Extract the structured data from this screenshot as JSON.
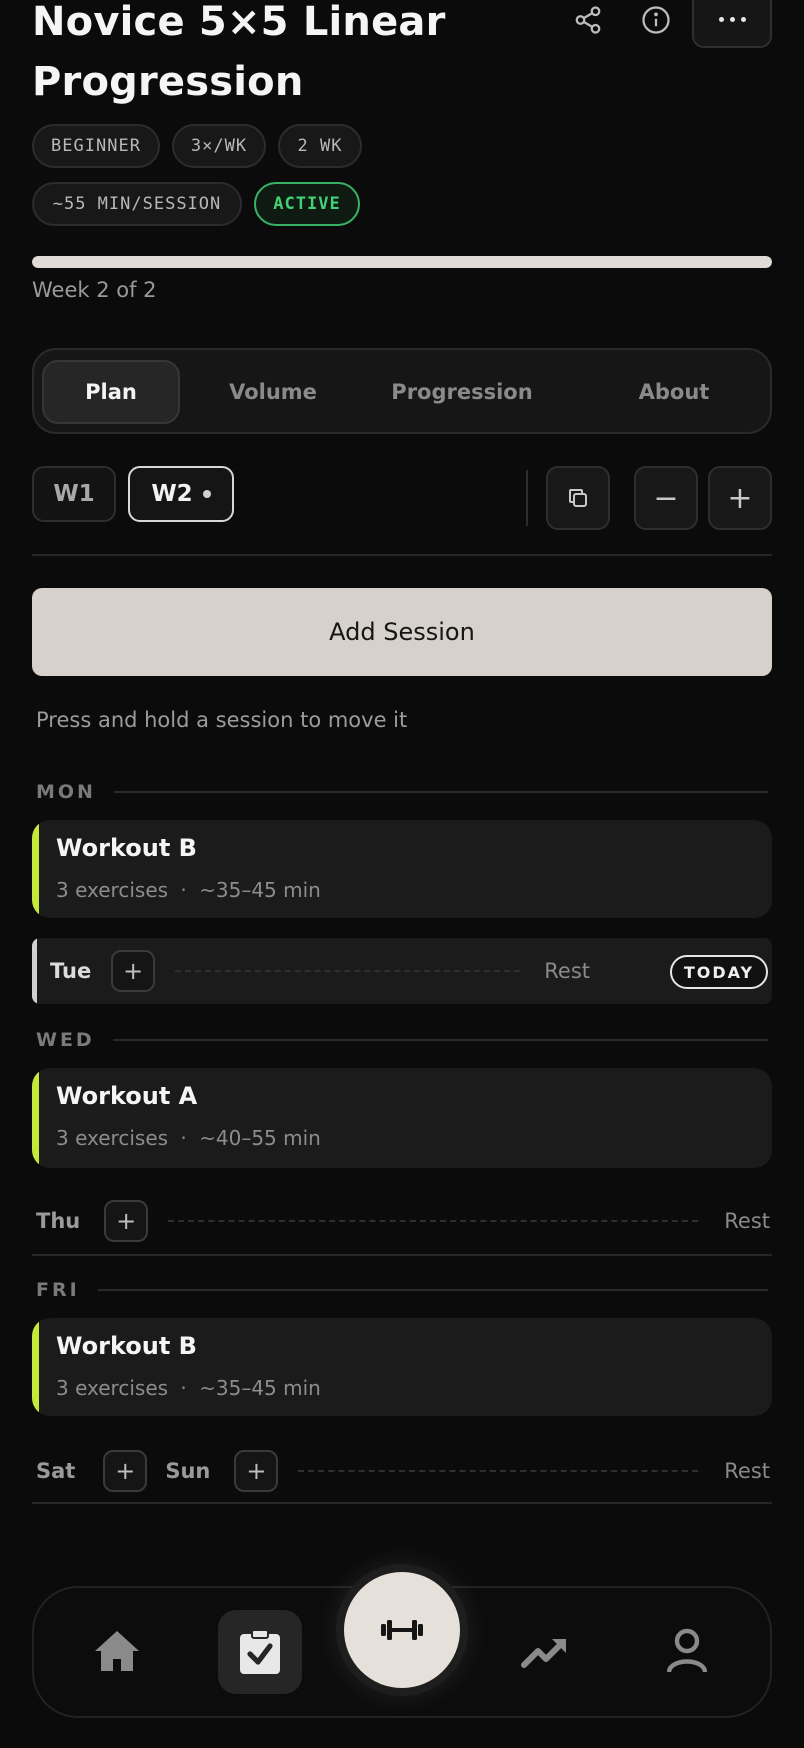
{
  "program": {
    "title": "Novice 5×5 Linear Progression",
    "tags": [
      "BEGINNER",
      "3×/WK",
      "2 WK",
      "~55 MIN/SESSION"
    ],
    "status": "ACTIVE",
    "progress_fraction": 1.0,
    "week_label": "Week 2 of 2"
  },
  "header_icons": [
    "share-icon",
    "info-icon",
    "more-icon"
  ],
  "tabs": [
    {
      "label": "Plan",
      "selected": true
    },
    {
      "label": "Volume",
      "selected": false
    },
    {
      "label": "Progression",
      "selected": false
    },
    {
      "label": "About",
      "selected": false
    }
  ],
  "weeks": [
    {
      "label": "W1",
      "selected": false
    },
    {
      "label": "W2",
      "selected": true
    }
  ],
  "week_actions": {
    "duplicate_icon": "copy-icon",
    "remove": "−",
    "add": "+"
  },
  "add_session_label": "Add Session",
  "hint": "Press and hold a session to move it",
  "schedule": {
    "mon": {
      "header": "MON",
      "name": "Workout B",
      "exercises": "3 exercises",
      "sep": "·",
      "duration": "~35–45 min"
    },
    "tue": {
      "day": "Tue",
      "add": "+",
      "rest": "Rest",
      "badge": "TODAY"
    },
    "wed": {
      "header": "WED",
      "name": "Workout A",
      "exercises": "3 exercises",
      "sep": "·",
      "duration": "~40–55 min"
    },
    "thu": {
      "day": "Thu",
      "add": "+",
      "rest": "Rest"
    },
    "fri": {
      "header": "FRI",
      "name": "Workout B",
      "exercises": "3 exercises",
      "sep": "·",
      "duration": "~35–45 min"
    },
    "weekend": {
      "sat": "Sat",
      "sun": "Sun",
      "add": "+",
      "rest": "Rest"
    }
  },
  "colors": {
    "accent_bar": "#c6e83a",
    "active_badge": "#43d177",
    "primary_button": "#d6d1cb"
  },
  "bottom_nav": [
    "home-icon",
    "plan-clipboard-icon",
    "workout-dumbbell-icon",
    "progress-trend-icon",
    "profile-icon"
  ]
}
